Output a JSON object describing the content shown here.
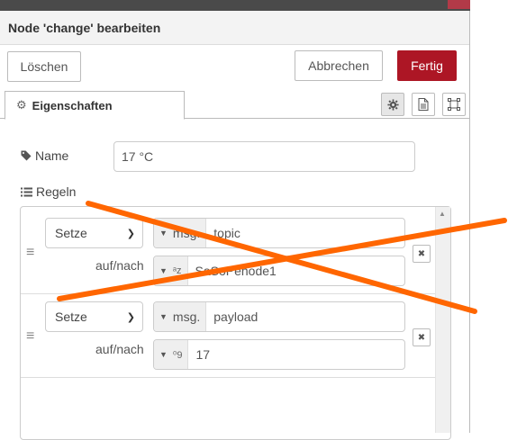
{
  "header": {
    "title": "Node 'change' bearbeiten"
  },
  "buttons": {
    "delete_label": "Löschen",
    "cancel_label": "Abbrechen",
    "done_label": "Fertig"
  },
  "tabs": {
    "active_label": "Eigenschaften"
  },
  "form": {
    "name_label": "Name",
    "name_value": "17 °C",
    "rules_label": "Regeln",
    "to_label": "auf/nach"
  },
  "rules": [
    {
      "action": "Setze",
      "target_type": "msg.",
      "target_value": "topic",
      "value_type_symbol": "ᵃz",
      "value": "SaSoPenode1"
    },
    {
      "action": "Setze",
      "target_type": "msg.",
      "target_value": "payload",
      "value_type_symbol": "⁰9",
      "value": "17"
    }
  ],
  "icons": {
    "gear": "gear-icon",
    "tag": "tag-icon",
    "list": "list-icon",
    "info": "info-icon",
    "description": "description-icon",
    "appearance": "appearance-icon",
    "remove": "remove-icon",
    "drag": "drag-handle-icon"
  },
  "colors": {
    "primary_button": "#ad1625",
    "annotation_cross": "#ff6600"
  }
}
